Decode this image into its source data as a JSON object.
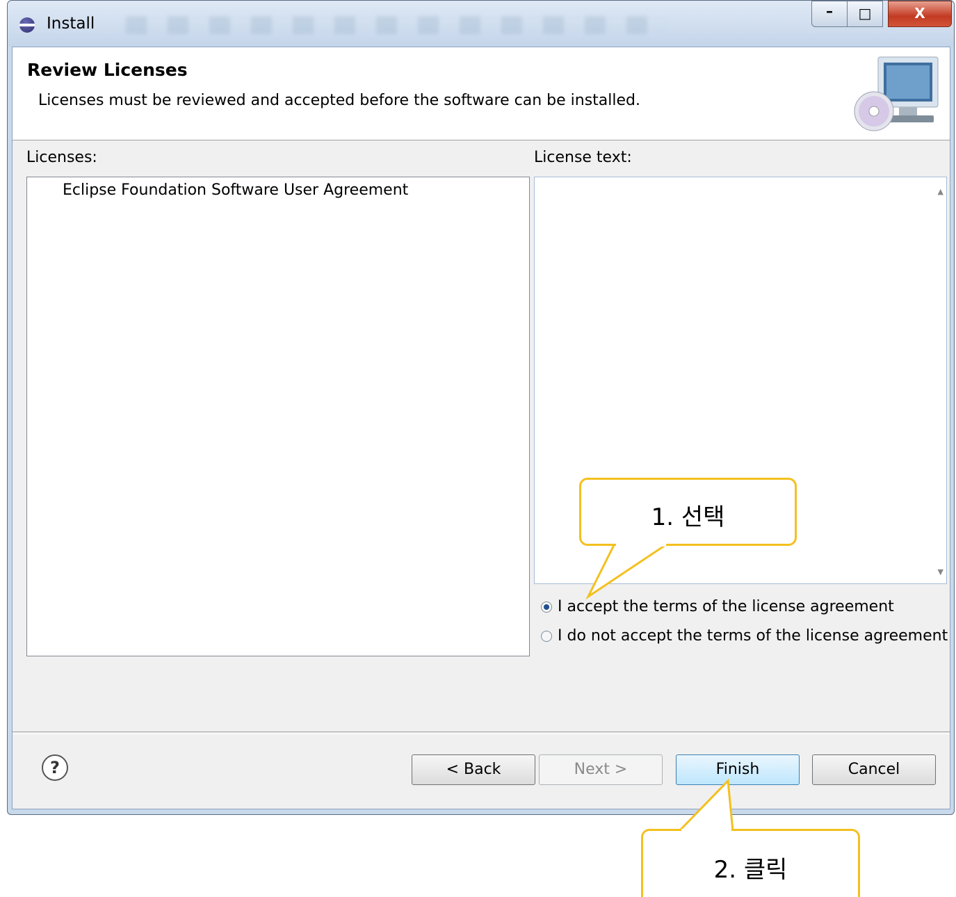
{
  "window": {
    "title": "Install",
    "controls": {
      "minimize": "–",
      "maximize": "□",
      "close": "X"
    }
  },
  "banner": {
    "title": "Review Licenses",
    "description": "Licenses must be reviewed and accepted before the software can be installed.",
    "icon": "computer-cd-icon"
  },
  "licenses": {
    "label": "Licenses:",
    "items": [
      "Eclipse Foundation Software User Agreement"
    ]
  },
  "license_text": {
    "label": "License text:",
    "content": ""
  },
  "options": {
    "accept": {
      "label": "I accept the terms of the license agreement",
      "checked": true
    },
    "decline": {
      "label": "I do not accept the terms of the license agreement",
      "checked": false
    }
  },
  "buttons": {
    "help": "?",
    "back": "< Back",
    "next": "Next >",
    "finish": "Finish",
    "cancel": "Cancel"
  },
  "annotations": {
    "step1": "1. 선택",
    "step2": "2. 클릭"
  },
  "colors": {
    "callout_border": "#f4c01e",
    "radio_selected": "#1f4f8f",
    "finish_border": "#3c7fb1"
  }
}
